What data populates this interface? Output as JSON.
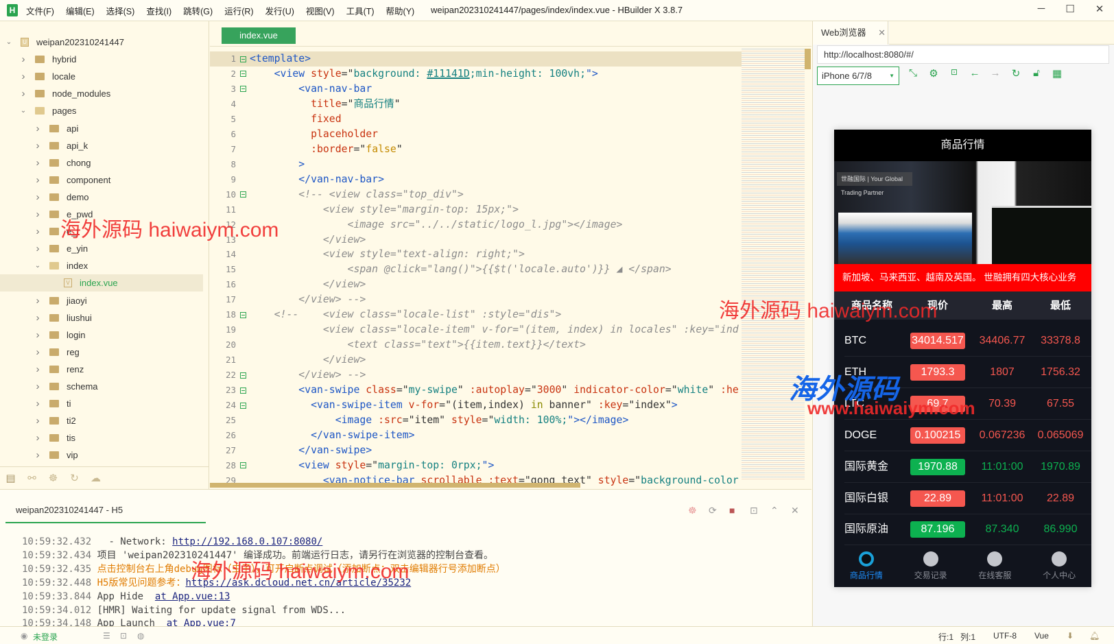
{
  "app": {
    "title": "weipan202310241447/pages/index/index.vue - HBuilder X 3.8.7",
    "logo": "H",
    "menus": [
      "文件(F)",
      "编辑(E)",
      "选择(S)",
      "查找(I)",
      "跳转(G)",
      "运行(R)",
      "发行(U)",
      "视图(V)",
      "工具(T)",
      "帮助(Y)"
    ],
    "window_buttons": [
      "─",
      "☐",
      "✕"
    ]
  },
  "sidebar": {
    "items": [
      {
        "label": "weipan202310241447",
        "level": 0,
        "type": "project",
        "expanded": true
      },
      {
        "label": "hybrid",
        "level": 1,
        "type": "folder"
      },
      {
        "label": "locale",
        "level": 1,
        "type": "folder"
      },
      {
        "label": "node_modules",
        "level": 1,
        "type": "folder"
      },
      {
        "label": "pages",
        "level": 1,
        "type": "folder",
        "expanded": true
      },
      {
        "label": "api",
        "level": 2,
        "type": "folder"
      },
      {
        "label": "api_k",
        "level": 2,
        "type": "folder"
      },
      {
        "label": "chong",
        "level": 2,
        "type": "folder"
      },
      {
        "label": "component",
        "level": 2,
        "type": "folder"
      },
      {
        "label": "demo",
        "level": 2,
        "type": "folder"
      },
      {
        "label": "e_pwd",
        "level": 2,
        "type": "folder"
      },
      {
        "label": "e_t",
        "level": 2,
        "type": "folder"
      },
      {
        "label": "e_yin",
        "level": 2,
        "type": "folder"
      },
      {
        "label": "index",
        "level": 2,
        "type": "folder",
        "expanded": true
      },
      {
        "label": "index.vue",
        "level": 3,
        "type": "file",
        "selected": true
      },
      {
        "label": "jiaoyi",
        "level": 2,
        "type": "folder"
      },
      {
        "label": "liushui",
        "level": 2,
        "type": "folder"
      },
      {
        "label": "login",
        "level": 2,
        "type": "folder"
      },
      {
        "label": "reg",
        "level": 2,
        "type": "folder"
      },
      {
        "label": "renz",
        "level": 2,
        "type": "folder"
      },
      {
        "label": "schema",
        "level": 2,
        "type": "folder"
      },
      {
        "label": "ti",
        "level": 2,
        "type": "folder"
      },
      {
        "label": "ti2",
        "level": 2,
        "type": "folder"
      },
      {
        "label": "tis",
        "level": 2,
        "type": "folder"
      },
      {
        "label": "vip",
        "level": 2,
        "type": "folder"
      }
    ],
    "tools": [
      "project-icon",
      "run-icon",
      "debug-icon",
      "history-icon",
      "cloud-icon"
    ]
  },
  "editor": {
    "tab": "index.vue",
    "lines": [
      {
        "n": 1,
        "f": 1,
        "cur": 1,
        "t": [
          [
            "<template>",
            "t"
          ]
        ]
      },
      {
        "n": 2,
        "f": 1,
        "t": [
          [
            "    <view ",
            "t"
          ],
          [
            "style",
            "a"
          ],
          [
            "=\"",
            "p"
          ],
          [
            "background: ",
            "s"
          ],
          [
            "#11141D",
            "s u"
          ],
          [
            ";min-height: 100vh;",
            "s"
          ],
          [
            "\">",
            "t"
          ]
        ]
      },
      {
        "n": 3,
        "f": 1,
        "t": [
          [
            "        <van-nav-bar",
            "t"
          ]
        ]
      },
      {
        "n": 4,
        "t": [
          [
            "          title",
            "a"
          ],
          [
            "=\"",
            "p"
          ],
          [
            "商品行情",
            "s"
          ],
          [
            "\"",
            "p"
          ]
        ]
      },
      {
        "n": 5,
        "t": [
          [
            "          fixed",
            "a"
          ]
        ]
      },
      {
        "n": 6,
        "t": [
          [
            "          placeholder",
            "a"
          ]
        ]
      },
      {
        "n": 7,
        "t": [
          [
            "          :border",
            "a"
          ],
          [
            "=\"",
            "p"
          ],
          [
            "false",
            "n"
          ],
          [
            "\"",
            "p"
          ]
        ]
      },
      {
        "n": 8,
        "t": [
          [
            "        >",
            "t"
          ]
        ]
      },
      {
        "n": 9,
        "t": [
          [
            "        </van-nav-bar>",
            "t"
          ]
        ]
      },
      {
        "n": 10,
        "f": 1,
        "t": [
          [
            "        <!-- <view class=\"top_div\">",
            "c"
          ]
        ]
      },
      {
        "n": 11,
        "t": [
          [
            "            <view style=\"margin-top: 15px;\">",
            "c"
          ]
        ]
      },
      {
        "n": 12,
        "t": [
          [
            "                <image src=\"../../static/logo_l.jpg\"></image>",
            "c"
          ]
        ]
      },
      {
        "n": 13,
        "t": [
          [
            "            </view>",
            "c"
          ]
        ]
      },
      {
        "n": 14,
        "t": [
          [
            "            <view style=\"text-align: right;\">",
            "c"
          ]
        ]
      },
      {
        "n": 15,
        "t": [
          [
            "                <span @click=\"lang()\">{{$t('locale.auto')}} ◢ </span>",
            "c"
          ]
        ]
      },
      {
        "n": 16,
        "t": [
          [
            "            </view>",
            "c"
          ]
        ]
      },
      {
        "n": 17,
        "t": [
          [
            "        </view> -->",
            "c"
          ]
        ]
      },
      {
        "n": 18,
        "f": 1,
        "t": [
          [
            "    <!--    <view class=\"locale-list\" :style=\"dis\">",
            "c"
          ]
        ]
      },
      {
        "n": 19,
        "t": [
          [
            "            <view class=\"locale-item\" v-for=\"(item, index) in locales\" :key=\"ind",
            "c"
          ]
        ]
      },
      {
        "n": 20,
        "t": [
          [
            "                <text class=\"text\">{{item.text}}</text>",
            "c"
          ]
        ]
      },
      {
        "n": 21,
        "t": [
          [
            "            </view>",
            "c"
          ]
        ]
      },
      {
        "n": 22,
        "f": 1,
        "t": [
          [
            "        </view> -->",
            "c"
          ]
        ]
      },
      {
        "n": 23,
        "f": 1,
        "t": [
          [
            "        <van-swipe ",
            "t"
          ],
          [
            "class",
            "a"
          ],
          [
            "=\"",
            "p"
          ],
          [
            "my-swipe",
            "s"
          ],
          [
            "\" ",
            "p"
          ],
          [
            ":autoplay",
            "a"
          ],
          [
            "=\"",
            "p"
          ],
          [
            "3000",
            "a"
          ],
          [
            "\" ",
            "p"
          ],
          [
            "indicator-color",
            "a"
          ],
          [
            "=\"",
            "p"
          ],
          [
            "white",
            "s"
          ],
          [
            "\" ",
            "p"
          ],
          [
            ":he",
            "a"
          ]
        ]
      },
      {
        "n": 24,
        "f": 1,
        "t": [
          [
            "          <van-swipe-item ",
            "t"
          ],
          [
            "v-for",
            "a"
          ],
          [
            "=\"(item,index) ",
            "p"
          ],
          [
            "in",
            "k"
          ],
          [
            " banner\" ",
            "p"
          ],
          [
            ":key",
            "a"
          ],
          [
            "=\"index\"",
            "p"
          ],
          [
            ">",
            "t"
          ]
        ]
      },
      {
        "n": 25,
        "t": [
          [
            "              <image ",
            "t"
          ],
          [
            ":src",
            "a"
          ],
          [
            "=\"item\" ",
            "p"
          ],
          [
            "style",
            "a"
          ],
          [
            "=\"",
            "p"
          ],
          [
            "width: 100%;",
            "s"
          ],
          [
            "\"></image>",
            "t"
          ]
        ]
      },
      {
        "n": 26,
        "t": [
          [
            "          </van-swipe-item>",
            "t"
          ]
        ]
      },
      {
        "n": 27,
        "t": [
          [
            "        </van-swipe>",
            "t"
          ]
        ]
      },
      {
        "n": 28,
        "f": 1,
        "t": [
          [
            "        <view ",
            "t"
          ],
          [
            "style",
            "a"
          ],
          [
            "=\"",
            "p"
          ],
          [
            "margin-top: 0rpx;",
            "s"
          ],
          [
            "\">",
            "t"
          ]
        ]
      },
      {
        "n": 29,
        "t": [
          [
            "            <van-notice-bar ",
            "t"
          ],
          [
            "scrollable ",
            "a"
          ],
          [
            ":text",
            "a"
          ],
          [
            "=\"gong_text\" ",
            "p"
          ],
          [
            "style",
            "a"
          ],
          [
            "=\"",
            "p"
          ],
          [
            "background-color",
            "s"
          ]
        ]
      }
    ]
  },
  "browser": {
    "tab": "Web浏览器",
    "close": "✕",
    "url": "http://localhost:8080/#/",
    "device": "iPhone 6/7/8",
    "tools": [
      "resize-icon",
      "settings-icon",
      "console-icon",
      "back-icon",
      "forward-icon",
      "refresh-icon",
      "lock-icon",
      "qrcode-icon"
    ]
  },
  "phone": {
    "title": "商品行情",
    "banner_caption": "世融国际 | Your Global Trading Partner",
    "notice": "新加坡、马来西亚、越南及英国。 世融拥有四大核心业务",
    "headers": [
      "商品名称",
      "现价",
      "最高",
      "最低"
    ],
    "rows": [
      {
        "name": "BTC",
        "price": "34014.517",
        "high": "34406.77",
        "low": "33378.8",
        "trend": "down"
      },
      {
        "name": "ETH",
        "price": "1793.3",
        "high": "1807",
        "low": "1756.32",
        "trend": "down"
      },
      {
        "name": "LTC",
        "price": "69.7",
        "high": "70.39",
        "low": "67.55",
        "trend": "down"
      },
      {
        "name": "DOGE",
        "price": "0.100215",
        "high": "0.067236",
        "low": "0.065069",
        "trend": "down"
      },
      {
        "name": "国际黄金",
        "price": "1970.88",
        "high": "11:01:00",
        "low": "1970.89",
        "trend": "up"
      },
      {
        "name": "国际白银",
        "price": "22.89",
        "high": "11:01:00",
        "low": "22.89",
        "trend": "down"
      },
      {
        "name": "国际原油",
        "price": "87.196",
        "high": "87.340",
        "low": "86.990",
        "trend": "up"
      }
    ],
    "nav": [
      "商品行情",
      "交易记录",
      "在线客服",
      "个人中心"
    ],
    "colors": {
      "up": "#0db150",
      "down": "#f5574f",
      "active": "#1e90ff"
    }
  },
  "console": {
    "tab": "weipan202310241447 - H5",
    "lines": [
      {
        "time": "10:59:32.432",
        "parts": [
          [
            "  - Network: ",
            ""
          ],
          [
            "http://192.168.0.107:8080/",
            "lnk"
          ]
        ]
      },
      {
        "time": "10:59:32.434",
        "parts": [
          [
            "项目 'weipan202310241447' 编译成功。前端运行日志，请另行在浏览器的控制台查看。",
            ""
          ]
        ]
      },
      {
        "time": "10:59:32.435",
        "parts": [
          [
            "点击控制台右上角debug图标（虫子），可开启断点调试（添加断点：双击编辑器行号添加断点）",
            "orange"
          ]
        ]
      },
      {
        "time": "10:59:32.448",
        "parts": [
          [
            "H5版常见问题参考：",
            "orange"
          ],
          [
            "https://ask.dcloud.net.cn/article/35232",
            "lnk"
          ]
        ]
      },
      {
        "time": "10:59:33.844",
        "parts": [
          [
            "App Hide  ",
            ""
          ],
          [
            "at App.vue:13",
            "lnk"
          ]
        ]
      },
      {
        "time": "10:59:34.012",
        "parts": [
          [
            "[HMR] Waiting for update signal from WDS...",
            ""
          ]
        ]
      },
      {
        "time": "10:59:34.148",
        "parts": [
          [
            "App Launch  ",
            ""
          ],
          [
            "at App.vue:7",
            "lnk"
          ]
        ]
      }
    ]
  },
  "status": {
    "login": "未登录",
    "row": "行:1",
    "col": "列:1",
    "encoding": "UTF-8",
    "lang": "Vue"
  },
  "watermarks": [
    "海外源码 haiwaiym.com",
    "海外源码",
    "www.haiwaiym.com"
  ]
}
